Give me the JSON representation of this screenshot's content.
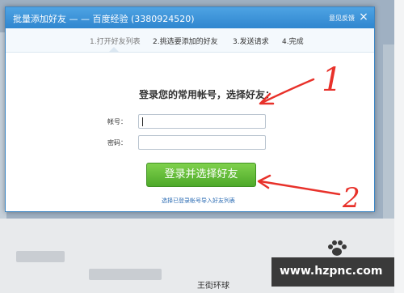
{
  "dialog": {
    "title": "批量添加好友 — — 百度经验 (3380924520)",
    "feedback_label": "意见反馈",
    "close_label": "×"
  },
  "steps": [
    {
      "label": "1.打开好友列表",
      "active": true
    },
    {
      "label": "2.挑选要添加的好友",
      "active": false
    },
    {
      "label": "3.发送请求",
      "active": false
    },
    {
      "label": "4.完成",
      "active": false
    }
  ],
  "form": {
    "prompt": "登录您的常用帐号，选择好友：",
    "account_label": "帐号：",
    "account_value": "",
    "password_label": "密码：",
    "password_value": "",
    "login_button": "登录并选择好友",
    "import_link": "选择已登录帐号导入好友列表"
  },
  "annotations": [
    {
      "label": "1",
      "color": "#e8312a"
    },
    {
      "label": "2",
      "color": "#e8312a"
    }
  ],
  "footer": {
    "bottom_text": "王街环球"
  },
  "watermark": {
    "text": "www.hzpnc.com"
  },
  "colors": {
    "title_bar": "#2f86cf",
    "button_green": "#4ea92a",
    "link_blue": "#2d6db4",
    "annotation_red": "#e8312a"
  }
}
